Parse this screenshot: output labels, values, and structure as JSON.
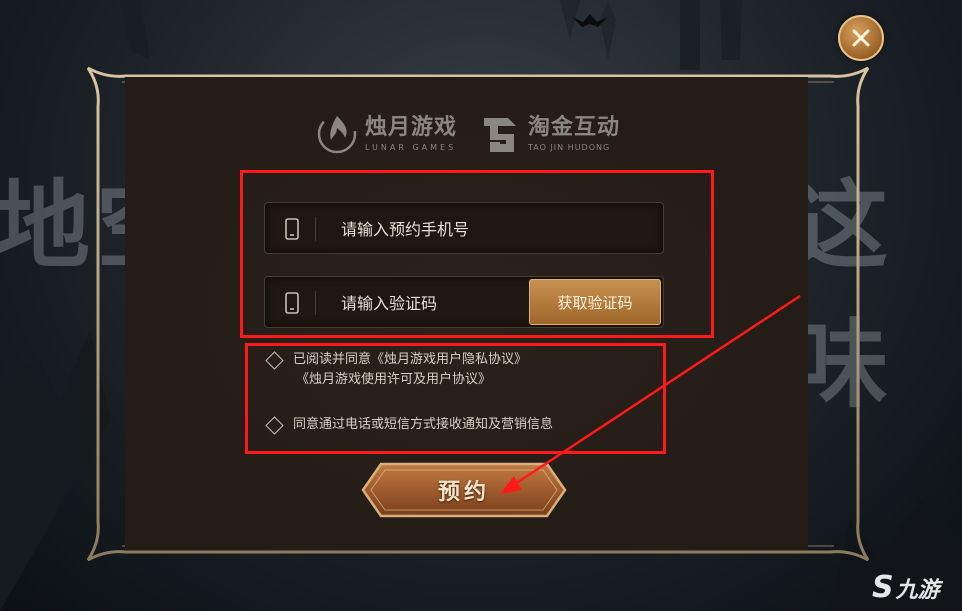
{
  "background": {
    "left_chars": "地空",
    "right_chars": "这味"
  },
  "close_button": {
    "icon": "close-icon"
  },
  "logos": {
    "lunar": {
      "cn": "烛月游戏",
      "en": "LUNAR GAMES",
      "icon": "flame-moon-icon"
    },
    "taojin": {
      "cn": "淘金互动",
      "en": "TAO JIN HUDONG",
      "icon": "taojin-logo-icon"
    }
  },
  "form": {
    "phone": {
      "placeholder": "请输入预约手机号",
      "value": "",
      "icon": "phone-icon"
    },
    "code": {
      "placeholder": "请输入验证码",
      "value": "",
      "icon": "phone-icon"
    },
    "get_code_label": "获取验证码"
  },
  "agreements": {
    "privacy_line1": "已阅读并同意《烛月游戏用户隐私协议》",
    "privacy_line2": "《烛月游戏使用许可及用户协议》",
    "marketing": "同意通过电话或短信方式接收通知及营销信息"
  },
  "reserve_label": "预约",
  "watermark": {
    "glyph": "S",
    "text": "九游"
  },
  "colors": {
    "accent": "#b07838",
    "highlight": "#ff1a1a",
    "panel": "#241c17"
  }
}
